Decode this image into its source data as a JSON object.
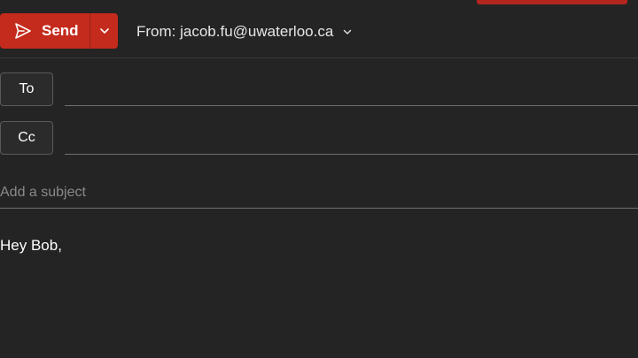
{
  "toolbar": {
    "send_label": "Send",
    "send_icon": "send-icon",
    "dropdown_icon": "chevron-down-icon",
    "from_label": "From: jacob.fu@uwaterloo.ca"
  },
  "recipients": {
    "to_label": "To",
    "to_value": "",
    "cc_label": "Cc",
    "cc_value": ""
  },
  "subject": {
    "placeholder": "Add a subject",
    "value": ""
  },
  "body": {
    "text": "Hey Bob,"
  },
  "colors": {
    "accent": "#c42b1c",
    "background": "#242424"
  }
}
